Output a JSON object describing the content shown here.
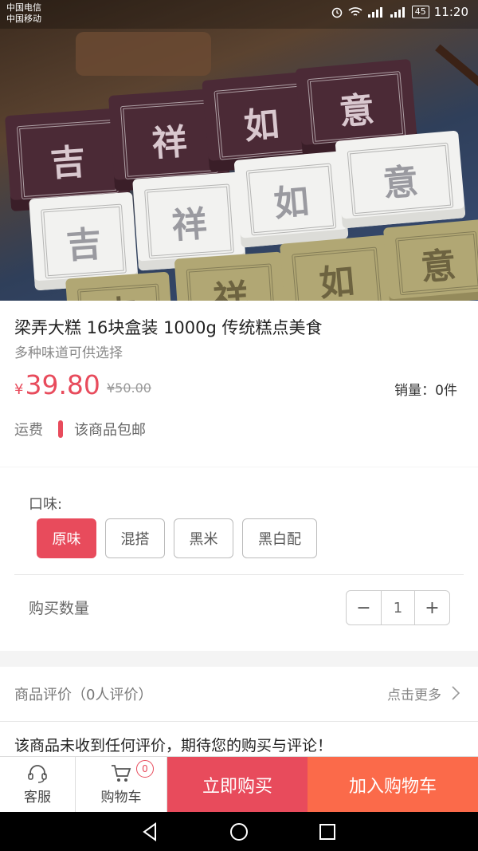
{
  "status_bar": {
    "carrier1": "中国电信",
    "carrier2": "中国移动",
    "battery": "45",
    "time": "11:20"
  },
  "hero": {
    "cake_chars_row1": [
      "吉",
      "祥",
      "如",
      "意"
    ],
    "cake_chars_row2": [
      "吉",
      "祥",
      "如",
      "意"
    ],
    "cake_chars_row3": [
      "吉",
      "祥",
      "如",
      "意"
    ]
  },
  "product": {
    "title": "梁弄大糕 16块盒装 1000g 传统糕点美食",
    "subtitle": "多种味道可供选择",
    "currency": "¥",
    "price": "39.80",
    "original_price": "¥50.00",
    "sales": "销量：0件",
    "shipping_label": "运费",
    "shipping_text": "该商品包邮"
  },
  "options": {
    "flavor_label": "口味:",
    "flavors": [
      "原味",
      "混搭",
      "黑米",
      "黑白配"
    ],
    "selected_index": 0,
    "quantity_label": "购买数量",
    "quantity": "1",
    "minus": "−",
    "plus": "+"
  },
  "reviews": {
    "title": "商品评价（0人评价）",
    "more": "点击更多",
    "empty_text": "该商品未收到任何评价，期待您的购买与评论！"
  },
  "bottom_bar": {
    "service_label": "客服",
    "cart_label": "购物车",
    "cart_count": "0",
    "buy_now": "立即购买",
    "add_to_cart": "加入购物车"
  },
  "colors": {
    "accent": "#e84b5c",
    "add_cart": "#fb6a4a"
  }
}
